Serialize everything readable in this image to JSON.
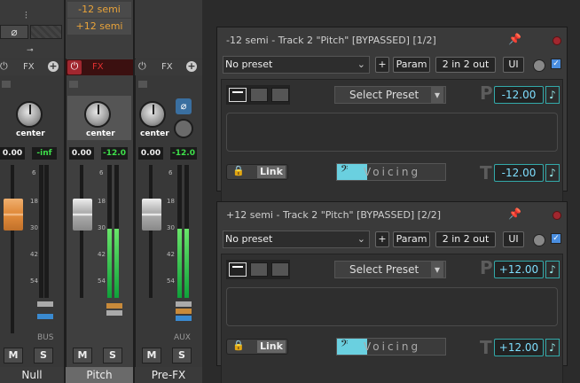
{
  "mixer": {
    "presets": [
      "-12 semi",
      "+12 semi"
    ],
    "fx_label": "FX",
    "pan_label": "center",
    "ticks": [
      "6",
      "18",
      "30",
      "42",
      "54"
    ],
    "strips": [
      {
        "name": "Null",
        "vol": "0.00",
        "peak": "-inf",
        "bus": "BUS",
        "mute": "M",
        "solo": "S"
      },
      {
        "name": "Pitch",
        "vol": "0.00",
        "peak": "-12.0",
        "mute": "M",
        "solo": "S"
      },
      {
        "name": "Pre-FX",
        "vol": "0.00",
        "peak": "-12.0",
        "bus": "AUX",
        "mute": "M",
        "solo": "S"
      }
    ],
    "meter_levels": [
      0,
      0.52,
      0.52
    ]
  },
  "windows": [
    {
      "title": "-12 semi - Track 2 \"Pitch\" [BYPASSED] [1/2]",
      "preset": "No preset",
      "plus": "+",
      "param": "Param",
      "routing": "2 in 2 out",
      "ui": "UI",
      "select_preset": "Select Preset",
      "p_label": "P",
      "t_label": "T",
      "pitch_value": "-12.00",
      "tune_value": "-12.00",
      "note": "♪",
      "link": "Link",
      "voicing": "Voicing",
      "clef": "𝄢"
    },
    {
      "title": "+12 semi - Track 2 \"Pitch\" [BYPASSED] [2/2]",
      "preset": "No preset",
      "plus": "+",
      "param": "Param",
      "routing": "2 in 2 out",
      "ui": "UI",
      "select_preset": "Select Preset",
      "p_label": "P",
      "t_label": "T",
      "pitch_value": "+12.00",
      "tune_value": "+12.00",
      "note": "♪",
      "link": "Link",
      "voicing": "Voicing",
      "clef": "𝄢"
    }
  ],
  "colors": {
    "accent": "#6ad0e0",
    "meter": "#3ee04a",
    "preset_text": "#e8a33a",
    "bypass": "#a1272f"
  }
}
